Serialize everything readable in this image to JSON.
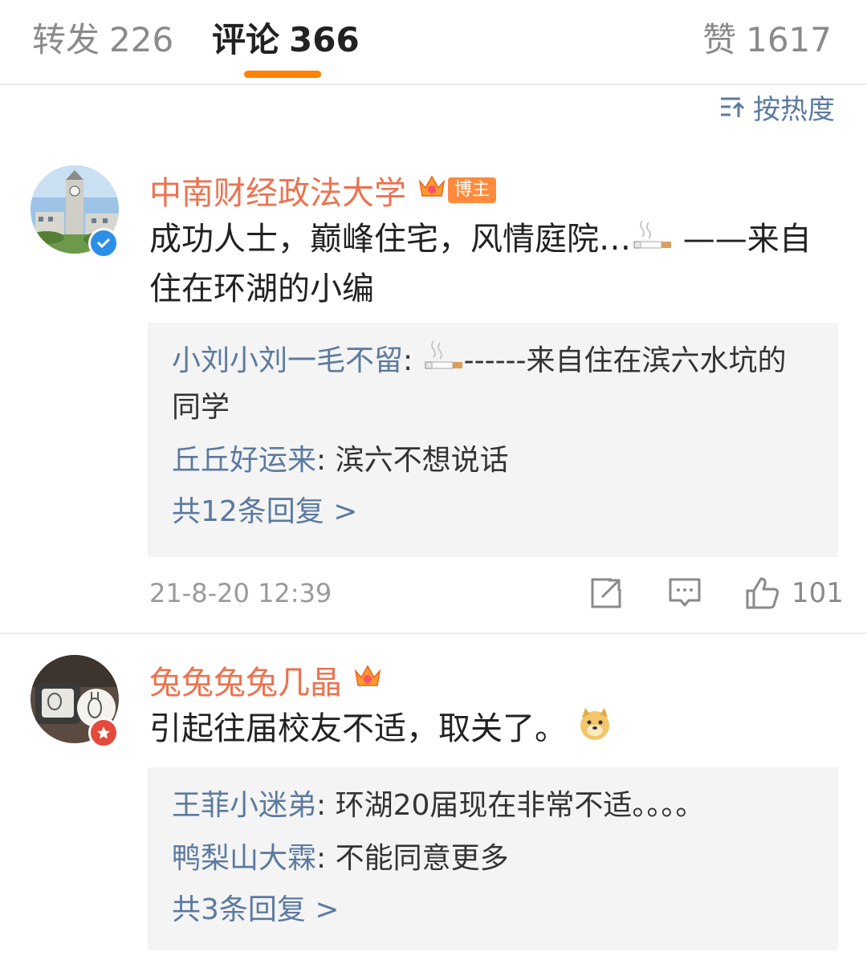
{
  "tabs": {
    "repost": {
      "label": "转发",
      "count": "226"
    },
    "comments": {
      "label": "评论",
      "count": "366"
    },
    "likes": {
      "label": "赞",
      "count": "1617"
    }
  },
  "sort": {
    "label": "按热度"
  },
  "comments": [
    {
      "username": "中南财经政法大学",
      "host_tag": "博主",
      "text_before": "成功人士，巅峰住宅，风情庭院…",
      "text_after": " ——来自住在环湖的小编",
      "replies": [
        {
          "name": "小刘小刘一毛不留",
          "before": "",
          "after": "------来自住在滨六水坑的同学"
        },
        {
          "name": "丘丘好运来",
          "text": "滨六不想说话"
        }
      ],
      "reply_count": "共12条回复 >",
      "time": "21-8-20 12:39",
      "likes": "101"
    },
    {
      "username": "兔兔兔兔几晶",
      "text": "引起往届校友不适，取关了。",
      "replies": [
        {
          "name": "王菲小迷弟",
          "text": "环湖20届现在非常不适。。。。"
        },
        {
          "name": "鸭梨山大霖",
          "text": "不能同意更多"
        }
      ],
      "reply_count": "共3条回复 >"
    }
  ],
  "colors": {
    "accent": "#ff8200",
    "username": "#eb7350",
    "link": "#5b7a9f",
    "verified": "#2b8fe9"
  }
}
